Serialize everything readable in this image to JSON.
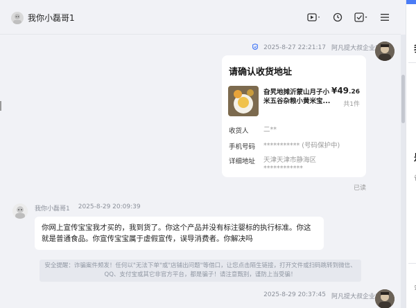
{
  "header": {
    "contact_name": "我你小磊哥1",
    "icons": [
      "video-call-icon",
      "chevron-down-icon",
      "history-icon",
      "task-check-icon",
      "chevron-down-icon",
      "menu-icon"
    ]
  },
  "messages": {
    "outgoing_1": {
      "timestamp": "2025-8-27 22:21:17",
      "sender": "阿凡提大叔企业店",
      "card": {
        "title": "请确认收货地址",
        "product_name": "旮旯地摊沂蒙山月子小米五谷杂粮小黄米宝...",
        "price_main": "¥49",
        "price_decimal": ".26",
        "quantity": "共1件",
        "fields": [
          {
            "label": "收货人",
            "value": "二**"
          },
          {
            "label": "手机号码",
            "value": "*********** (号码保护中)"
          },
          {
            "label": "详细地址",
            "value": "天津天津市静海区",
            "value2": "************"
          }
        ]
      },
      "read_status": "已读"
    },
    "incoming_1": {
      "sender": "我你小磊哥1",
      "timestamp": "2025-8-29 20:09:39",
      "text": "你网上宣传宝宝我才买的，我到货了。你这个产品并没有标注婴标的执行标准。你这就是普通食品。你宣传宝宝属于虚假宣传，误导消费者。你解决吗"
    },
    "notice": "安全提醒：诈骗案件频发！任何以\"无法下单\"或\"店铺出问题\"等借口，让您点击陌生链接，打开文件或扫码跳转到微信、QQ、支付宝或其它非官方平台，都是骗子！请注意甄别，谨防上当受骗！",
    "outgoing_2": {
      "timestamp": "2025-8-29 20:37:45",
      "sender": "阿凡提大叔企业店"
    }
  },
  "right_panel": {
    "char_1": "我",
    "char_2": "是",
    "small_1": "省",
    "small_2": "会"
  },
  "colors": {
    "background": "#f1f2f6",
    "accent": "#4a7cf6",
    "bubble": "#ffffff"
  }
}
